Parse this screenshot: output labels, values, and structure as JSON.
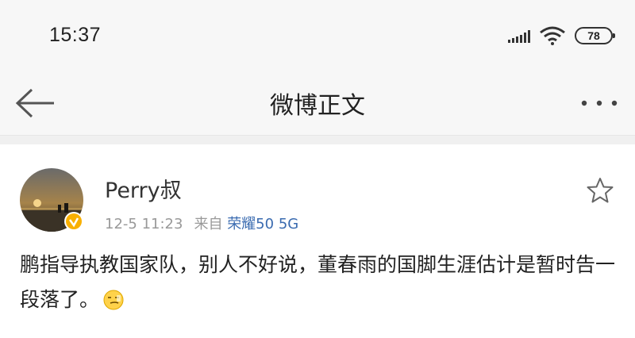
{
  "status_bar": {
    "time": "15:37",
    "battery": "78",
    "icons": [
      "signal-icon",
      "wifi-icon",
      "battery-icon"
    ]
  },
  "navbar": {
    "title": "微博正文",
    "back_icon": "back-arrow-icon",
    "more_icon": "more-icon"
  },
  "post": {
    "username": "Perry叔",
    "timestamp": "12-5 11:23",
    "source_prefix": "来自",
    "source_device": "荣耀50 5G",
    "content": "鹏指导执教国家队，别人不好说，董春雨的国脚生涯估计是暂时告一段落了。",
    "verified_color": "#f9b000",
    "source_color": "#3a6bb0"
  }
}
